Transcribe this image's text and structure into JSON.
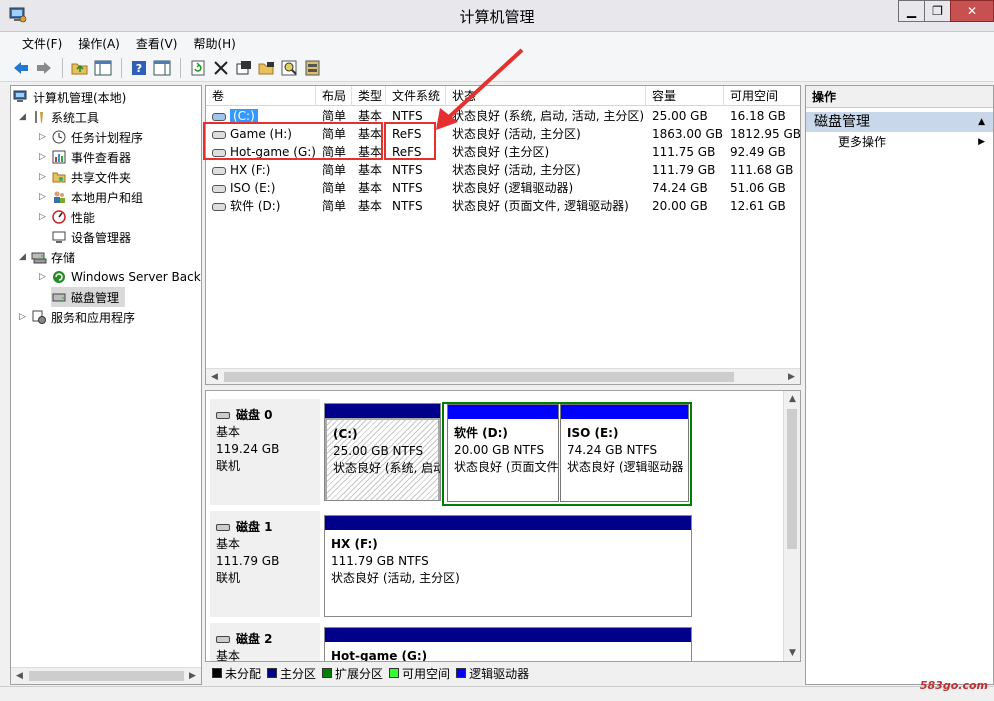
{
  "window": {
    "title": "计算机管理"
  },
  "window_buttons": {
    "minimize": "▁",
    "restore": "❐",
    "close": "✕"
  },
  "menu": [
    "文件(F)",
    "操作(A)",
    "查看(V)",
    "帮助(H)"
  ],
  "tree": {
    "root": "计算机管理(本地)",
    "system_tools": "系统工具",
    "task_scheduler": "任务计划程序",
    "event_viewer": "事件查看器",
    "shared_folders": "共享文件夹",
    "local_users": "本地用户和组",
    "performance": "性能",
    "device_manager": "设备管理器",
    "storage": "存储",
    "windows_server_backup": "Windows Server Back",
    "disk_management": "磁盘管理",
    "services_apps": "服务和应用程序"
  },
  "volume_table": {
    "columns": [
      "卷",
      "布局",
      "类型",
      "文件系统",
      "状态",
      "容量",
      "可用空间"
    ],
    "rows": [
      {
        "name": "(C:)",
        "layout": "简单",
        "type": "基本",
        "fs": "NTFS",
        "status": "状态良好 (系统, 启动, 活动, 主分区)",
        "capacity": "25.00 GB",
        "free": "16.18 GB"
      },
      {
        "name": "Game (H:)",
        "layout": "简单",
        "type": "基本",
        "fs": "ReFS",
        "status": "状态良好 (活动, 主分区)",
        "capacity": "1863.00 GB",
        "free": "1812.95 GB"
      },
      {
        "name": "Hot-game (G:)",
        "layout": "简单",
        "type": "基本",
        "fs": "ReFS",
        "status": "状态良好 (主分区)",
        "capacity": "111.75 GB",
        "free": "92.49 GB"
      },
      {
        "name": "HX (F:)",
        "layout": "简单",
        "type": "基本",
        "fs": "NTFS",
        "status": "状态良好 (活动, 主分区)",
        "capacity": "111.79 GB",
        "free": "111.68 GB"
      },
      {
        "name": "ISO (E:)",
        "layout": "简单",
        "type": "基本",
        "fs": "NTFS",
        "status": "状态良好 (逻辑驱动器)",
        "capacity": "74.24 GB",
        "free": "51.06 GB"
      },
      {
        "name": "软件 (D:)",
        "layout": "简单",
        "type": "基本",
        "fs": "NTFS",
        "status": "状态良好 (页面文件, 逻辑驱动器)",
        "capacity": "20.00 GB",
        "free": "12.61 GB"
      }
    ]
  },
  "disks": [
    {
      "name": "磁盘 0",
      "kind": "基本",
      "size": "119.24 GB",
      "state": "联机",
      "partitions": [
        {
          "name": "(C:)",
          "size": "25.00 GB NTFS",
          "status": "状态良好 (系统, 启动"
        },
        {
          "name": "软件 (D:)",
          "size": "20.00 GB NTFS",
          "status": "状态良好 (页面文件"
        },
        {
          "name": "ISO (E:)",
          "size": "74.24 GB NTFS",
          "status": "状态良好 (逻辑驱动器"
        }
      ]
    },
    {
      "name": "磁盘 1",
      "kind": "基本",
      "size": "111.79 GB",
      "state": "联机",
      "partitions": [
        {
          "name": "HX (F:)",
          "size": "111.79 GB NTFS",
          "status": "状态良好 (活动, 主分区)"
        }
      ]
    },
    {
      "name": "磁盘 2",
      "kind": "基本",
      "partitions": [
        {
          "name": "Hot-game (G:)"
        }
      ]
    }
  ],
  "legend": [
    {
      "label": "未分配",
      "color": "#000000"
    },
    {
      "label": "主分区",
      "color": "#00008b"
    },
    {
      "label": "扩展分区",
      "color": "#008000"
    },
    {
      "label": "可用空间",
      "color": "#33ff33"
    },
    {
      "label": "逻辑驱动器",
      "color": "#0000ff"
    }
  ],
  "actions": {
    "header": "操作",
    "section": "磁盘管理",
    "more": "更多操作"
  },
  "watermark": "583go.com",
  "colors": {
    "annotation": "#e53030",
    "primary_partition": "#00008b",
    "logical_drive": "#0000ff",
    "extended_partition": "#008000"
  }
}
